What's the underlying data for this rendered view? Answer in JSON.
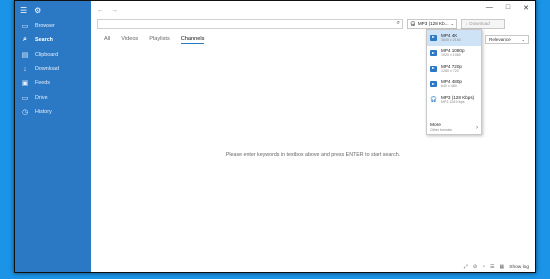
{
  "sidebar": {
    "items": [
      {
        "label": "Browser",
        "icon": "browser-icon",
        "glyph": "▭"
      },
      {
        "label": "Search",
        "icon": "search-icon",
        "glyph": "⌕"
      },
      {
        "label": "Clipboard",
        "icon": "clipboard-icon",
        "glyph": "▤"
      },
      {
        "label": "Download",
        "icon": "download-icon",
        "glyph": "↓"
      },
      {
        "label": "Feeds",
        "icon": "feeds-icon",
        "glyph": "▣"
      },
      {
        "label": "Drive",
        "icon": "drive-icon",
        "glyph": "▭"
      },
      {
        "label": "History",
        "icon": "history-icon",
        "glyph": "◷"
      }
    ]
  },
  "toolbar": {
    "format_selected": "MP3 (128 Kb...",
    "download_label": "Download",
    "search_placeholder": ""
  },
  "tabs": [
    "All",
    "Videos",
    "Playlists",
    "Channels"
  ],
  "sort": {
    "label_fragment": "ort",
    "value": "Relevance"
  },
  "placeholder_text": "Please enter keywords in textbox above and press ENTER to start search.",
  "format_menu": {
    "options": [
      {
        "title": "MP4 4K",
        "sub": "3840 x 2160",
        "type": "video"
      },
      {
        "title": "MP4 1080p",
        "sub": "1920 x 1080",
        "type": "video"
      },
      {
        "title": "MP4 720p",
        "sub": "1280 x 720",
        "type": "video"
      },
      {
        "title": "MP4 480p",
        "sub": "640 x 480",
        "type": "video"
      },
      {
        "title": "MP3 (128 Kbps)",
        "sub": "MP3 128 Kbps",
        "type": "audio"
      }
    ],
    "more_title": "More",
    "more_sub": "Other formats"
  },
  "statusbar": {
    "show_log": "Show log"
  },
  "colors": {
    "sidebar": "#2b78c5",
    "accent": "#2b78c5",
    "desktop": "#1b93e6",
    "selected": "#cfe3f7"
  }
}
